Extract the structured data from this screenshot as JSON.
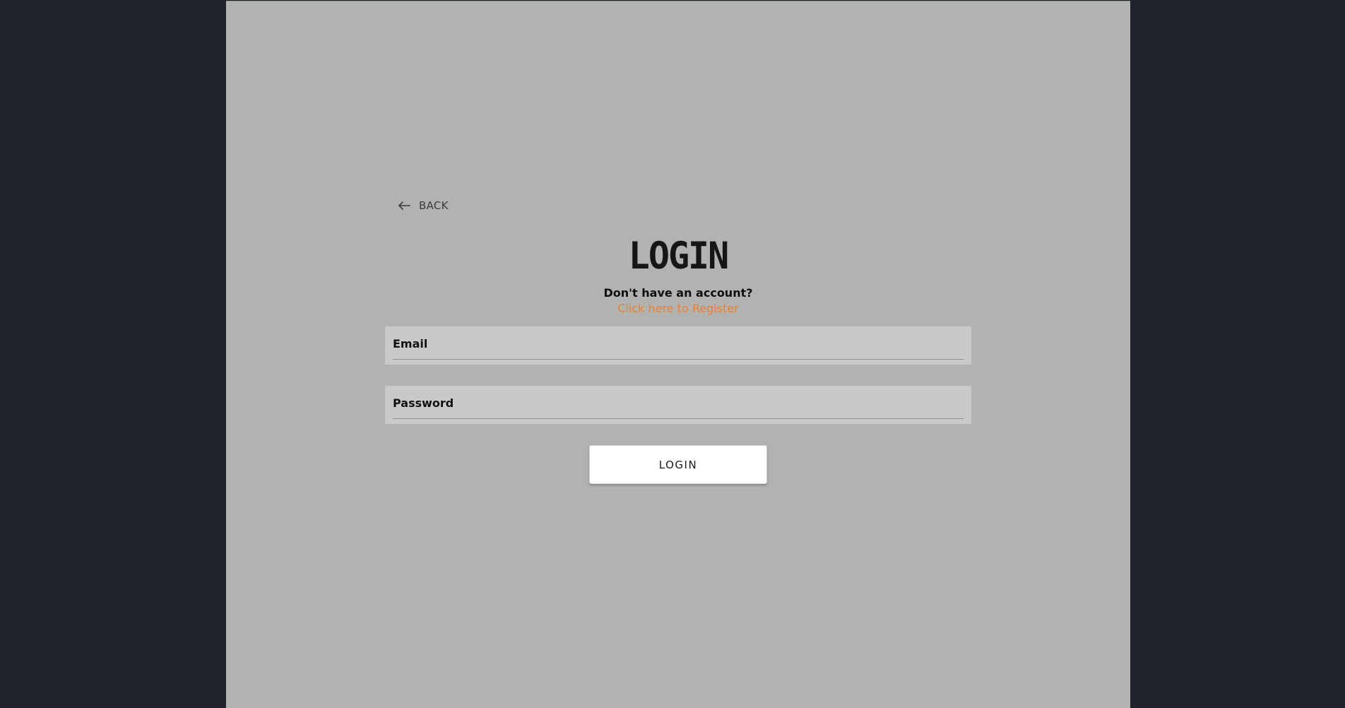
{
  "nav": {
    "back_label": "BACK",
    "back_icon": "arrow-left-icon"
  },
  "login": {
    "title": "LOGIN",
    "account_prompt": "Don't have an account?",
    "register_link": "Click here to Register",
    "email_label": "Email",
    "email_value": "",
    "password_label": "Password",
    "password_value": "",
    "submit_label": "LOGIN"
  },
  "colors": {
    "page_background": "#1f232b",
    "panel_background": "#b1b3b0",
    "field_background": "#c9cac7",
    "link_accent": "#ef7f2e",
    "button_background": "#ffffff"
  }
}
